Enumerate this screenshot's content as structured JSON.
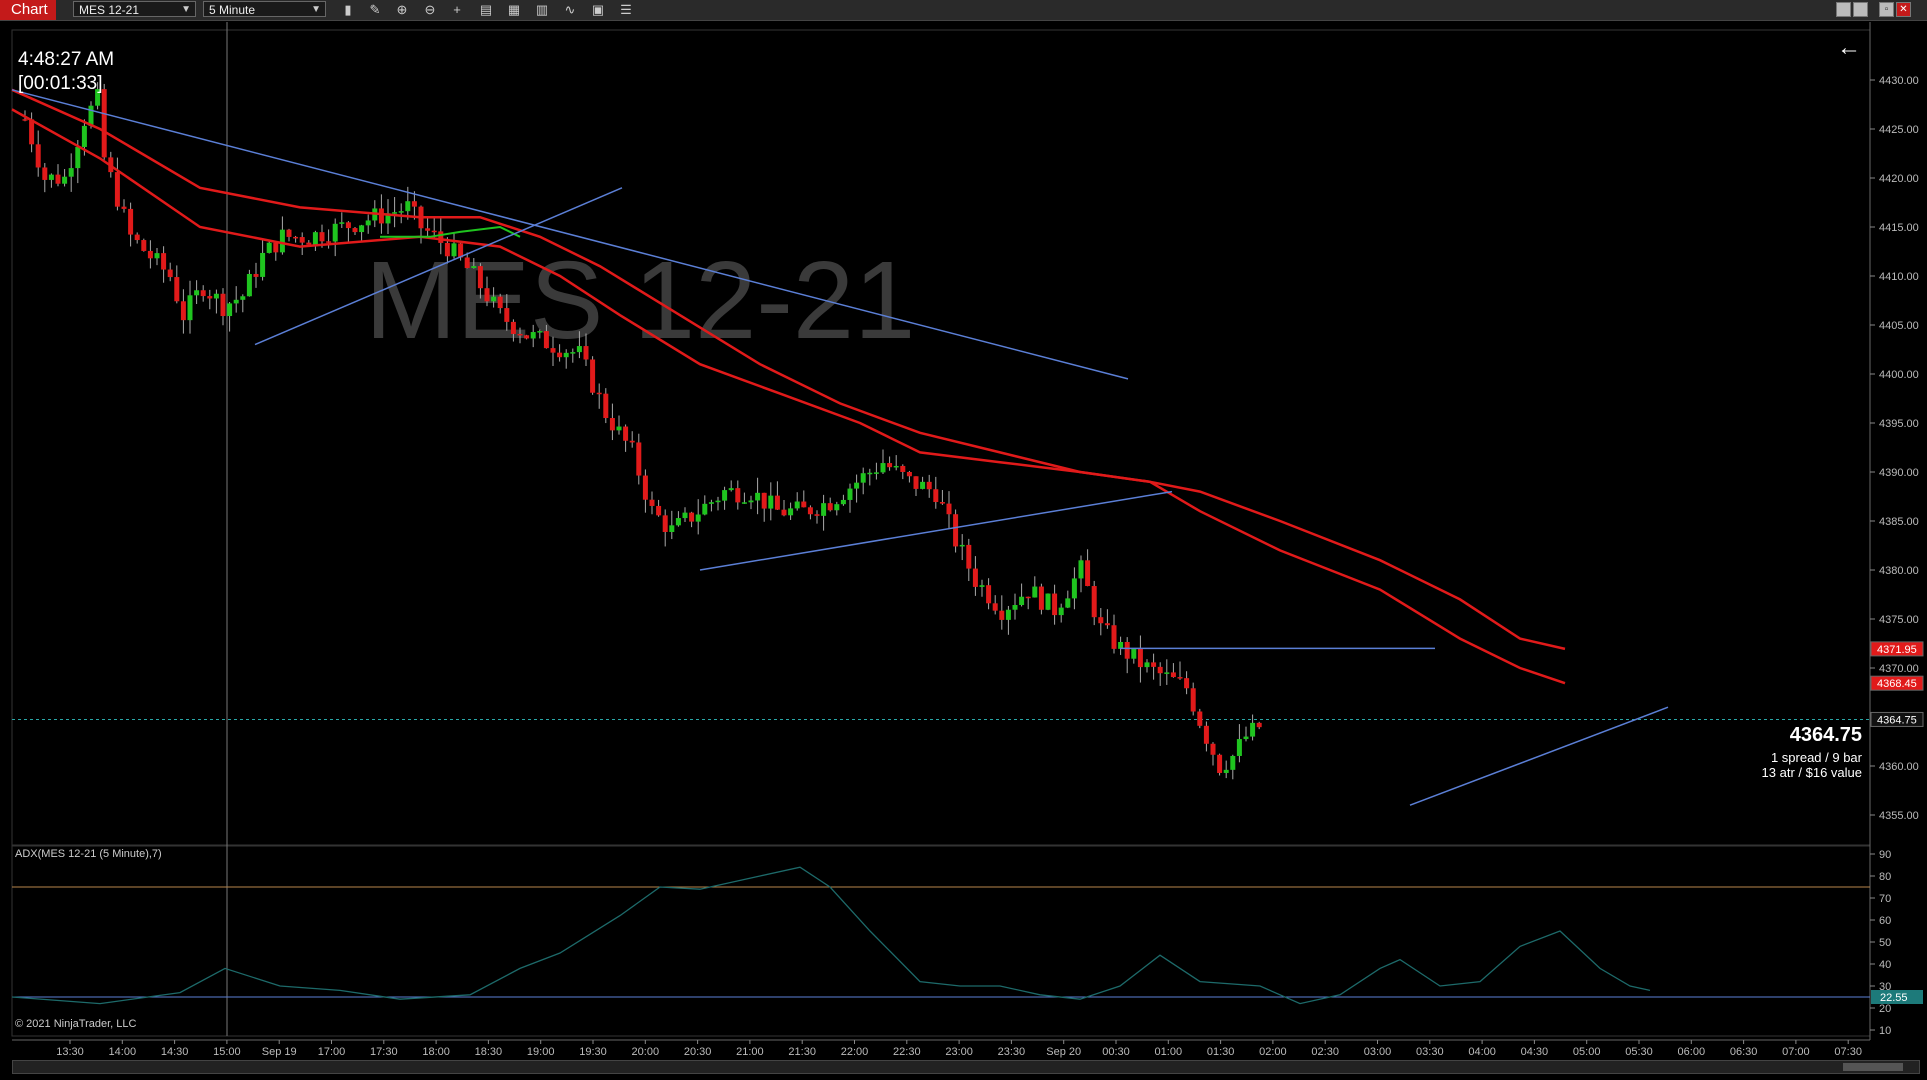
{
  "toolbar": {
    "tab_label": "Chart",
    "instrument": "MES 12-21",
    "interval": "5 Minute",
    "icons": [
      "bar-type-icon",
      "draw-tool-icon",
      "zoom-in-icon",
      "zoom-out-icon",
      "crosshair-icon",
      "data-box-icon",
      "template-icon",
      "indicators-icon",
      "strategies-icon",
      "properties-icon",
      "list-icon"
    ],
    "window_buttons": [
      "minimize-icon",
      "restore-icon",
      "maximize-icon",
      "close-icon"
    ]
  },
  "chart": {
    "time": "4:48:27 AM",
    "countdown": "[00:01:33]",
    "watermark": "MES 12-21",
    "current_price": "4364.75",
    "info_line1": "1 spread / 9 bar",
    "info_line2": "13 atr / $16 value",
    "price_ticks": [
      "4430.00",
      "4425.00",
      "4420.00",
      "4415.00",
      "4410.00",
      "4405.00",
      "4400.00",
      "4395.00",
      "4390.00",
      "4385.00",
      "4380.00",
      "4375.00",
      "4370.00",
      "4360.00",
      "4355.00"
    ],
    "price_tags": [
      {
        "label": "4371.95",
        "color": "#e11a1a"
      },
      {
        "label": "4368.45",
        "color": "#e11a1a"
      },
      {
        "label": "4364.75",
        "color": "#111111"
      }
    ],
    "time_labels": [
      "13:30",
      "14:00",
      "14:30",
      "15:00",
      "Sep 19",
      "17:00",
      "17:30",
      "18:00",
      "18:30",
      "19:00",
      "19:30",
      "20:00",
      "20:30",
      "21:00",
      "21:30",
      "22:00",
      "22:30",
      "23:00",
      "23:30",
      "Sep 20",
      "00:30",
      "01:00",
      "01:30",
      "02:00",
      "02:30",
      "03:00",
      "03:30",
      "04:00",
      "04:30",
      "05:00",
      "05:30",
      "06:00",
      "06:30",
      "07:00",
      "07:30"
    ],
    "colors": {
      "up": "#1fc41f",
      "down": "#e11a1a",
      "ema": "#e11a1a",
      "trendline": "#5b7fd6",
      "adx": "#1d6a6a",
      "level80": "#b8864b",
      "level25": "#5b7fd6",
      "price_line": "#2aa7a7"
    }
  },
  "adx": {
    "label": "ADX(MES 12-21 (5 Minute),7)",
    "value": "22.55",
    "ticks": [
      "90",
      "80",
      "70",
      "60",
      "50",
      "40",
      "30",
      "20",
      "10"
    ]
  },
  "footer": {
    "copyright": "© 2021 NinjaTrader, LLC"
  }
}
